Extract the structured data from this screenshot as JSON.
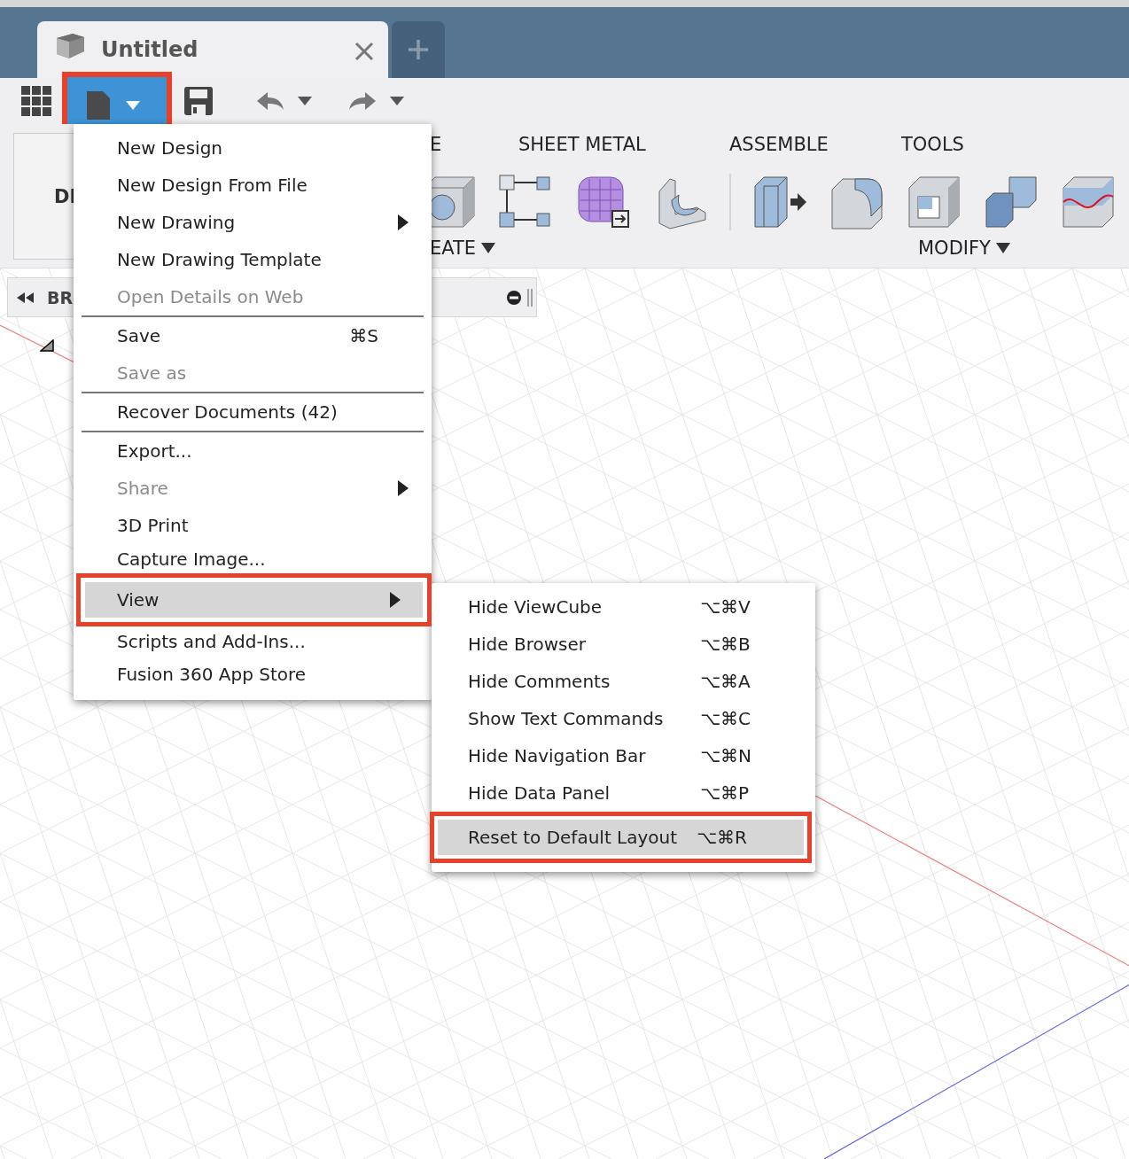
{
  "tabs": [
    {
      "title": "Untitled",
      "selected": true
    }
  ],
  "toolbar": {
    "file_button": {
      "annotated": true
    }
  },
  "ribbon": {
    "design_label": "DI",
    "tab_labels": [
      "E",
      "SHEET METAL",
      "ASSEMBLE",
      "TOOLS"
    ],
    "group_labels": [
      "EATE",
      "MODIFY"
    ]
  },
  "browser": {
    "label": "BR"
  },
  "file_menu": {
    "items": [
      {
        "kind": "item",
        "label": "New Design",
        "disabled": false,
        "submenu": false,
        "selected": false,
        "annotated": false
      },
      {
        "kind": "item",
        "label": "New Design From File",
        "disabled": false,
        "submenu": false,
        "selected": false,
        "annotated": false
      },
      {
        "kind": "item",
        "label": "New Drawing",
        "disabled": false,
        "submenu": true,
        "selected": false,
        "annotated": false
      },
      {
        "kind": "item",
        "label": "New Drawing Template",
        "disabled": false,
        "submenu": false,
        "selected": false,
        "annotated": false
      },
      {
        "kind": "item",
        "label": "Open Details on Web",
        "disabled": true,
        "submenu": false,
        "selected": false,
        "annotated": false
      },
      {
        "kind": "separator"
      },
      {
        "kind": "item",
        "label": "Save",
        "shortcut": "⌘S",
        "disabled": false,
        "submenu": false,
        "selected": false,
        "annotated": false
      },
      {
        "kind": "item",
        "label": "Save as",
        "disabled": true,
        "submenu": false,
        "selected": false,
        "annotated": false
      },
      {
        "kind": "separator"
      },
      {
        "kind": "item",
        "label": "Recover Documents (42)",
        "disabled": false,
        "submenu": false,
        "selected": false,
        "annotated": false
      },
      {
        "kind": "separator"
      },
      {
        "kind": "item",
        "label": "Export...",
        "disabled": false,
        "submenu": false,
        "selected": false,
        "annotated": false
      },
      {
        "kind": "item",
        "label": "Share",
        "disabled": true,
        "submenu": true,
        "selected": false,
        "annotated": false
      },
      {
        "kind": "item",
        "label": "3D Print",
        "disabled": false,
        "submenu": false,
        "selected": false,
        "annotated": false
      },
      {
        "kind": "item",
        "label": "Capture Image...",
        "disabled": false,
        "submenu": false,
        "selected": false,
        "annotated": false
      },
      {
        "kind": "item",
        "label": "View",
        "disabled": false,
        "submenu": true,
        "selected": true,
        "annotated": true
      },
      {
        "kind": "item",
        "label": "Scripts and Add-Ins...",
        "disabled": false,
        "submenu": false,
        "selected": false,
        "annotated": false
      },
      {
        "kind": "item",
        "label": "Fusion 360 App Store",
        "disabled": false,
        "submenu": false,
        "selected": false,
        "annotated": false
      }
    ]
  },
  "view_submenu": {
    "items": [
      {
        "label": "Hide ViewCube",
        "shortcut": "⌥⌘V",
        "selected": false,
        "annotated": false
      },
      {
        "label": "Hide Browser",
        "shortcut": "⌥⌘B",
        "selected": false,
        "annotated": false
      },
      {
        "label": "Hide Comments",
        "shortcut": "⌥⌘A",
        "selected": false,
        "annotated": false
      },
      {
        "label": "Show Text Commands",
        "shortcut": "⌥⌘C",
        "selected": false,
        "annotated": false
      },
      {
        "label": "Hide Navigation Bar",
        "shortcut": "⌥⌘N",
        "selected": false,
        "annotated": false
      },
      {
        "label": "Hide Data Panel",
        "shortcut": "⌥⌘P",
        "selected": false,
        "annotated": false
      },
      {
        "label": "Reset to Default Layout",
        "shortcut": "⌥⌘R",
        "selected": true,
        "annotated": true
      }
    ]
  }
}
